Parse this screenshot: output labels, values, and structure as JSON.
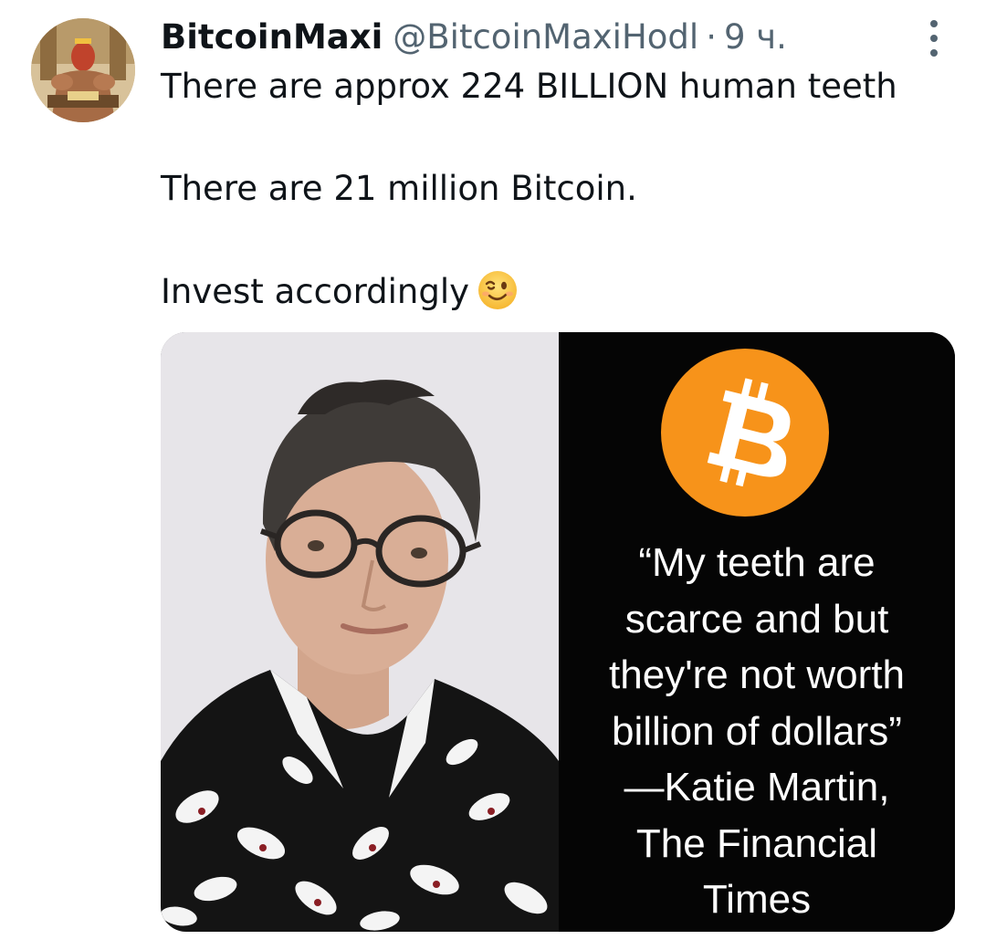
{
  "tweet": {
    "display_name": "BitcoinMaxi",
    "handle": "@BitcoinMaxiHodl",
    "separator": "·",
    "time": "9 ч.",
    "lines": [
      "There are approx 224 BILLION human teeth",
      "There are 21 million Bitcoin.",
      "Invest accordingly"
    ],
    "emoji": "winking-face"
  },
  "media": {
    "quote_lines": [
      "“My teeth are",
      "scarce and but",
      "they're not worth",
      "billion of dollars”",
      "—Katie Martin,",
      "The Financial",
      "Times"
    ],
    "logo": "bitcoin-logo",
    "colors": {
      "bitcoin_orange": "#f7931a",
      "quote_background": "#050505",
      "photo_background": "#e8e6ea"
    }
  },
  "icons": {
    "more": "more-options-icon"
  },
  "colors": {
    "text_primary": "#0f1419",
    "text_secondary": "#536471"
  }
}
